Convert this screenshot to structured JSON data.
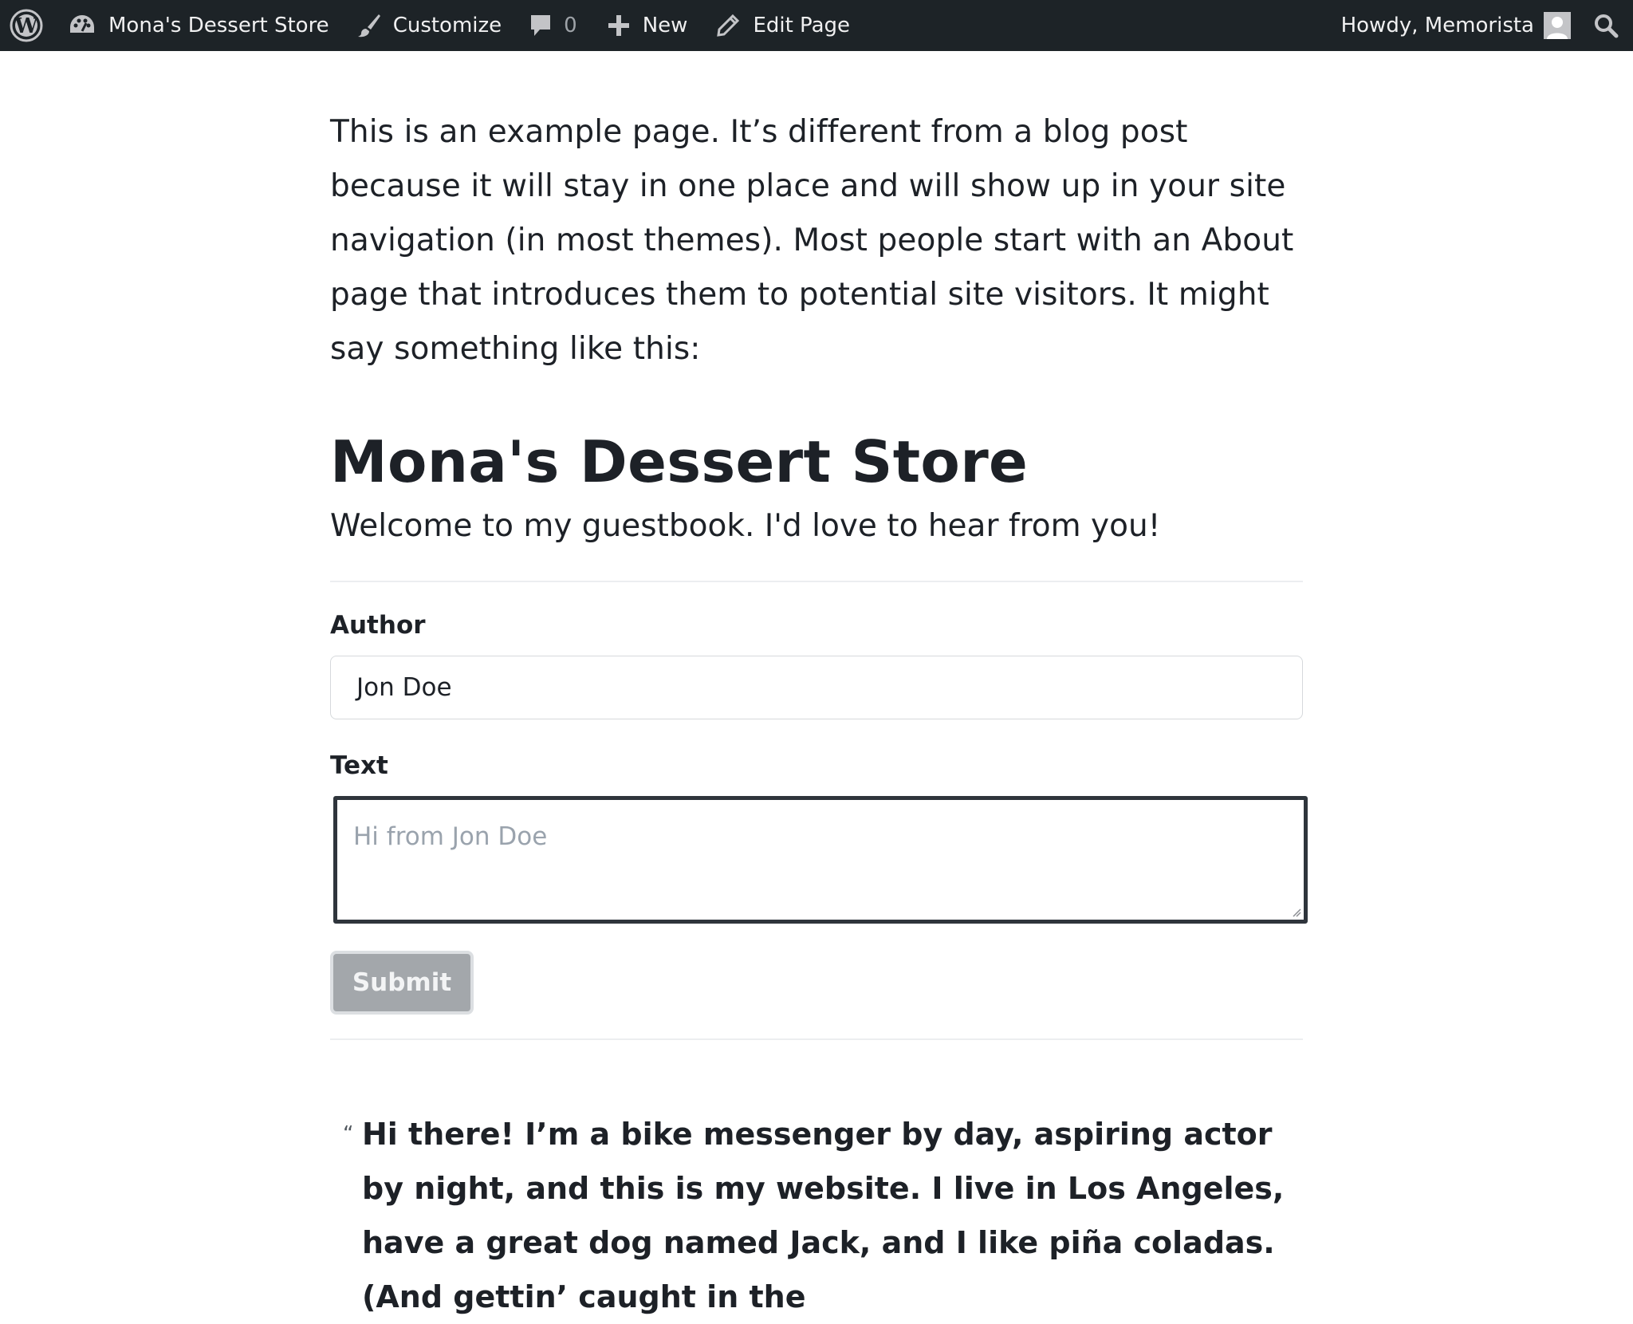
{
  "admin_bar": {
    "site_name": "Mona's Dessert Store",
    "customize": "Customize",
    "comments_count": "0",
    "new_label": "New",
    "edit_page": "Edit Page",
    "greeting": "Howdy, Memorista",
    "icons": {
      "wordpress": "wordpress-logo-icon",
      "dashboard": "dashboard-icon",
      "customize": "paintbrush-icon",
      "comments": "comment-bubble-icon",
      "new": "plus-icon",
      "edit": "pencil-icon",
      "avatar": "user-avatar-icon",
      "search": "search-icon"
    }
  },
  "page": {
    "intro_text": "This is an example page. It’s different from a blog post because it will stay in one place and will show up in your site navigation (in most themes). Most people start with an About page that introduces them to potential site visitors. It might say something like this:",
    "title": "Mona's Dessert Store",
    "welcome": "Welcome to my guestbook. I'd love to hear from you!"
  },
  "form": {
    "author_label": "Author",
    "author_value": "Jon Doe",
    "text_label": "Text",
    "text_placeholder": "Hi from Jon Doe",
    "submit_label": "Submit"
  },
  "quote": {
    "mark": "“",
    "text": "Hi there! I’m a bike messenger by day, aspiring actor by night, and this is my website. I live in Los Angeles, have a great dog named Jack, and I like piña coladas. (And gettin’ caught in the"
  },
  "colors": {
    "admin_bar_bg": "#1d2327",
    "text": "#1d2127",
    "submit_bg": "#a3a7ab",
    "textarea_border": "#2f353c"
  }
}
